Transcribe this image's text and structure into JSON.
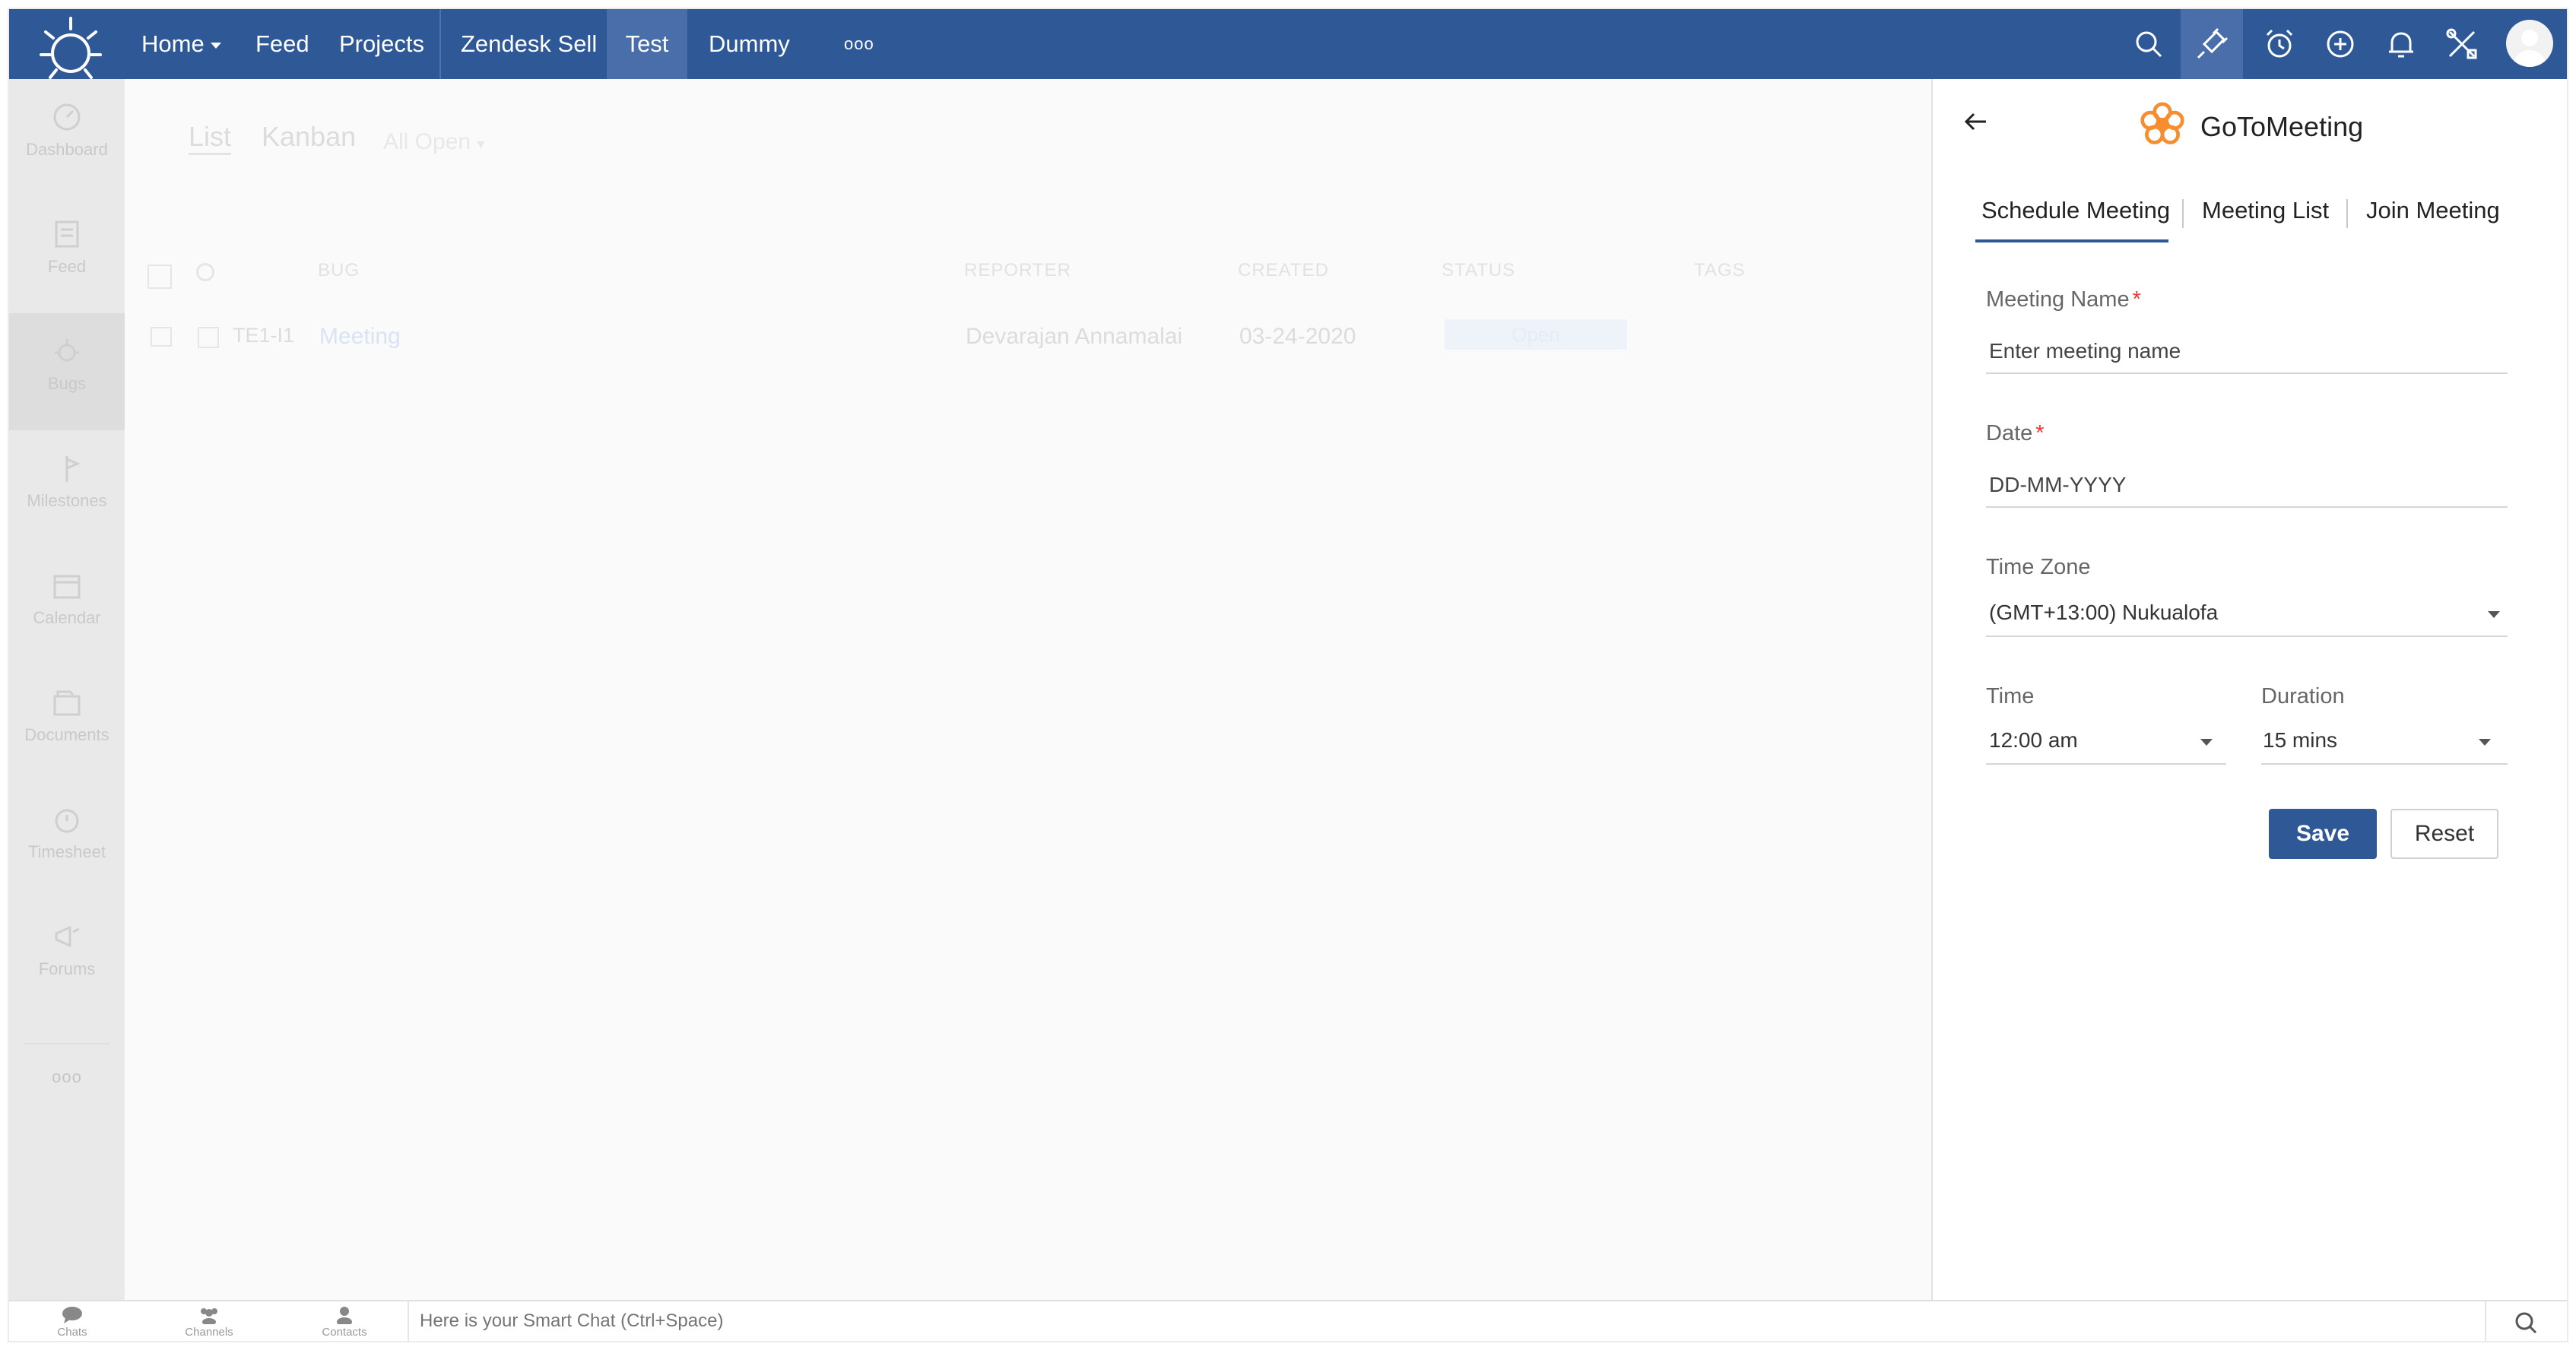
{
  "topnav": {
    "items": [
      {
        "label": "Home",
        "has_caret": true
      },
      {
        "label": "Feed"
      },
      {
        "label": "Projects"
      },
      {
        "label": "Zendesk Sell"
      },
      {
        "label": "Test",
        "active": true
      },
      {
        "label": "Dummy"
      }
    ],
    "more_label": "ooo",
    "icons": [
      "search-icon",
      "plug-icon",
      "alarm-clock-icon",
      "add-circle-icon",
      "bell-icon",
      "tools-icon",
      "user-avatar"
    ]
  },
  "sidebar": {
    "items": [
      {
        "label": "Dashboard",
        "icon": "dashboard-icon"
      },
      {
        "label": "Feed",
        "icon": "feed-icon"
      },
      {
        "label": "Bugs",
        "icon": "bug-icon",
        "active": true
      },
      {
        "label": "Milestones",
        "icon": "milestone-icon"
      },
      {
        "label": "Calendar",
        "icon": "calendar-icon"
      },
      {
        "label": "Documents",
        "icon": "documents-icon"
      },
      {
        "label": "Timesheet",
        "icon": "timesheet-icon"
      },
      {
        "label": "Forums",
        "icon": "forums-icon"
      }
    ],
    "more_label": "ooo"
  },
  "content": {
    "view_tabs": [
      "List",
      "Kanban"
    ],
    "filter": "All Open",
    "columns": [
      "BUG",
      "REPORTER",
      "CREATED",
      "STATUS",
      "TAGS"
    ],
    "rows": [
      {
        "id": "TE1-I1",
        "bug": "Meeting",
        "reporter": "Devarajan Annamalai",
        "created": "03-24-2020",
        "status": "Open"
      }
    ]
  },
  "panel": {
    "brand": "GoToMeeting",
    "tabs": [
      "Schedule Meeting",
      "Meeting List",
      "Join Meeting"
    ],
    "active_tab": "Schedule Meeting",
    "form": {
      "meeting_name_label": "Meeting Name",
      "meeting_name_placeholder": "Enter meeting name",
      "date_label": "Date",
      "date_placeholder": "DD-MM-YYYY",
      "required_mark": "*",
      "timezone_label": "Time Zone",
      "timezone_value": "(GMT+13:00) Nukualofa",
      "time_label": "Time",
      "time_value": "12:00 am",
      "duration_label": "Duration",
      "duration_value": "15 mins"
    },
    "save_label": "Save",
    "reset_label": "Reset"
  },
  "bottombar": {
    "items": [
      "Chats",
      "Channels",
      "Contacts"
    ],
    "smart_chat_placeholder": "Here is your Smart Chat (Ctrl+Space)"
  },
  "colors": {
    "brand_blue": "#2f5897",
    "required_red": "#e53935",
    "gotomeeting_orange": "#f68d2e"
  }
}
